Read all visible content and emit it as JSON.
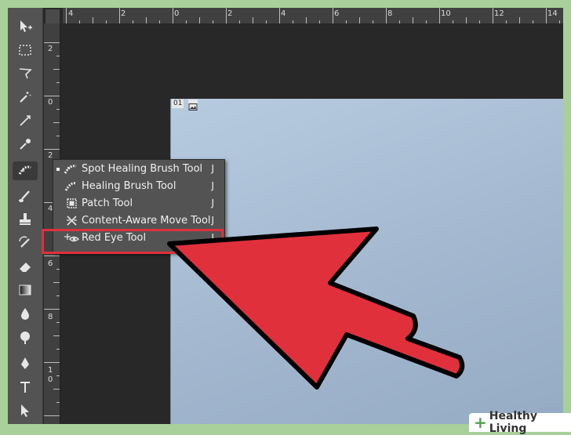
{
  "ruler": {
    "top_labels": [
      "4",
      "2",
      "0",
      "2",
      "4",
      "6",
      "8",
      "10",
      "12",
      "14"
    ],
    "left_labels": [
      "2",
      "0",
      "2",
      "4",
      "6",
      "8",
      "1",
      "0"
    ]
  },
  "document": {
    "tab_label": "01"
  },
  "flyout": {
    "items": [
      {
        "label": "Spot Healing Brush Tool",
        "shortcut": "J",
        "selected": true
      },
      {
        "label": "Healing Brush Tool",
        "shortcut": "J",
        "selected": false
      },
      {
        "label": "Patch Tool",
        "shortcut": "J",
        "selected": false
      },
      {
        "label": "Content-Aware Move Tool",
        "shortcut": "J",
        "selected": false
      },
      {
        "label": "Red Eye Tool",
        "shortcut": "J",
        "selected": false
      }
    ]
  },
  "colors": {
    "highlight": "#e0303c",
    "arrow_fill": "#e0303c",
    "panel": "#535353",
    "frame_border": "#a9cf9a"
  },
  "watermark": {
    "text": "Healthy Living"
  }
}
